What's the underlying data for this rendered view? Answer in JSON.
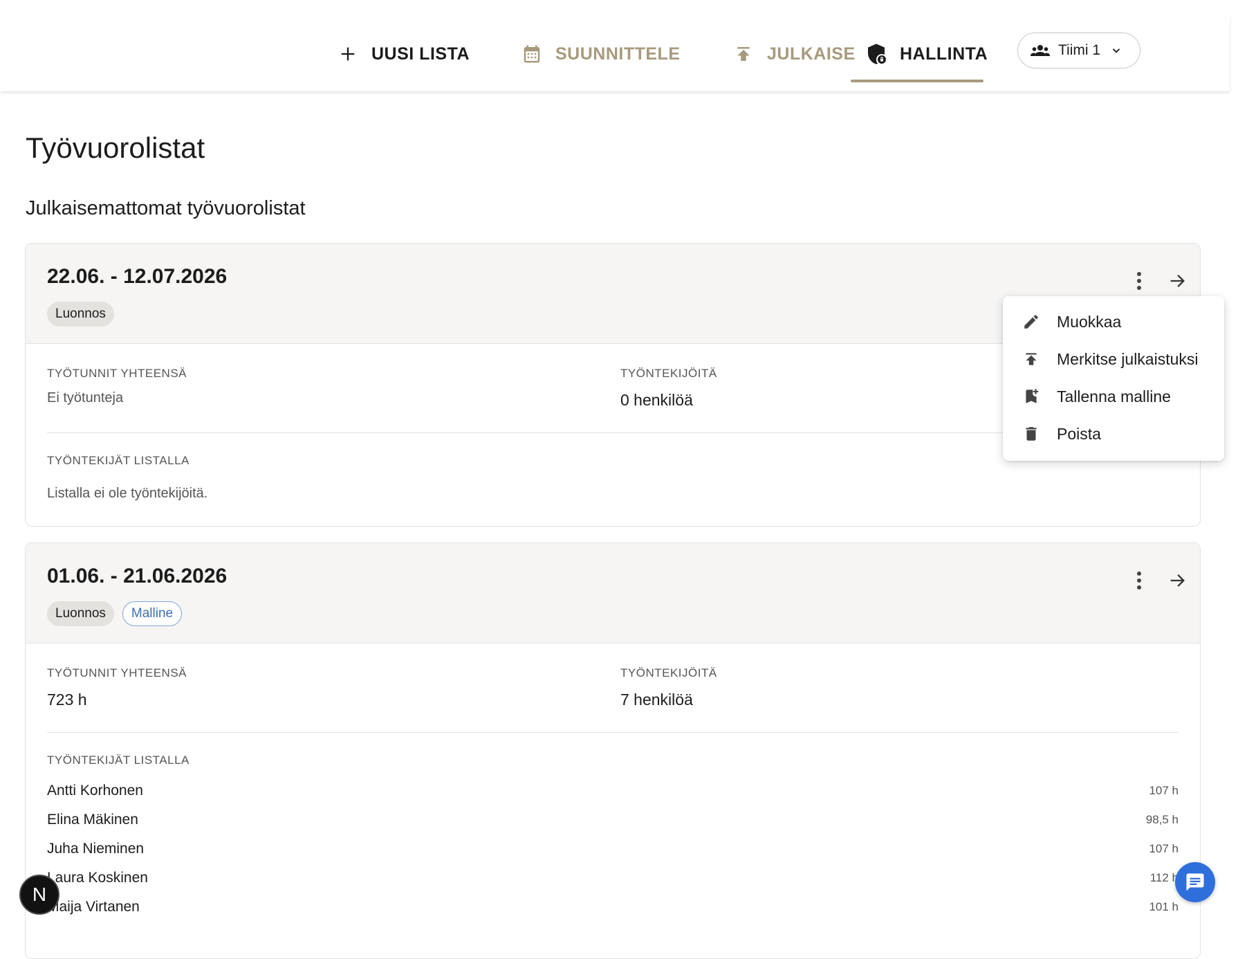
{
  "nav": {
    "new_list": "UUSI LISTA",
    "plan": "SUUNNITTELE",
    "publish": "JULKAISE",
    "admin": "HALLINTA",
    "team": "Tiimi 1",
    "active_color": "#a79a7c"
  },
  "page": {
    "title": "Työvuorolistat",
    "section": "Julkaisemattomat työvuorolistat"
  },
  "cards": [
    {
      "date_range": "22.06. - 12.07.2026",
      "chips": [
        "Luonnos"
      ],
      "hours_label": "TYÖTUNNIT YHTEENSÄ",
      "hours_value": "Ei työtunteja",
      "employees_label": "TYÖNTEKIJÖITÄ",
      "employees_value": "0 henkilöä",
      "list_label": "TYÖNTEKIJÄT LISTALLA",
      "empty_text": "Listalla ei ole työntekijöitä."
    },
    {
      "date_range": "01.06. - 21.06.2026",
      "chips": [
        "Luonnos",
        "Malline"
      ],
      "hours_label": "TYÖTUNNIT YHTEENSÄ",
      "hours_value": "723 h",
      "employees_label": "TYÖNTEKIJÖITÄ",
      "employees_value": "7 henkilöä",
      "list_label": "TYÖNTEKIJÄT LISTALLA",
      "employees": [
        {
          "name": "Antti Korhonen",
          "hours": "107 h"
        },
        {
          "name": "Elina Mäkinen",
          "hours": "98,5 h"
        },
        {
          "name": "Juha Nieminen",
          "hours": "107 h"
        },
        {
          "name": "Laura Koskinen",
          "hours": "112 h"
        },
        {
          "name": "Maija Virtanen",
          "hours": "101 h"
        }
      ]
    }
  ],
  "menu": {
    "edit": "Muokkaa",
    "mark_published": "Merkitse julkaistuksi",
    "save_template": "Tallenna malline",
    "delete": "Poista"
  },
  "floating": {
    "avatar_letter": "N"
  }
}
